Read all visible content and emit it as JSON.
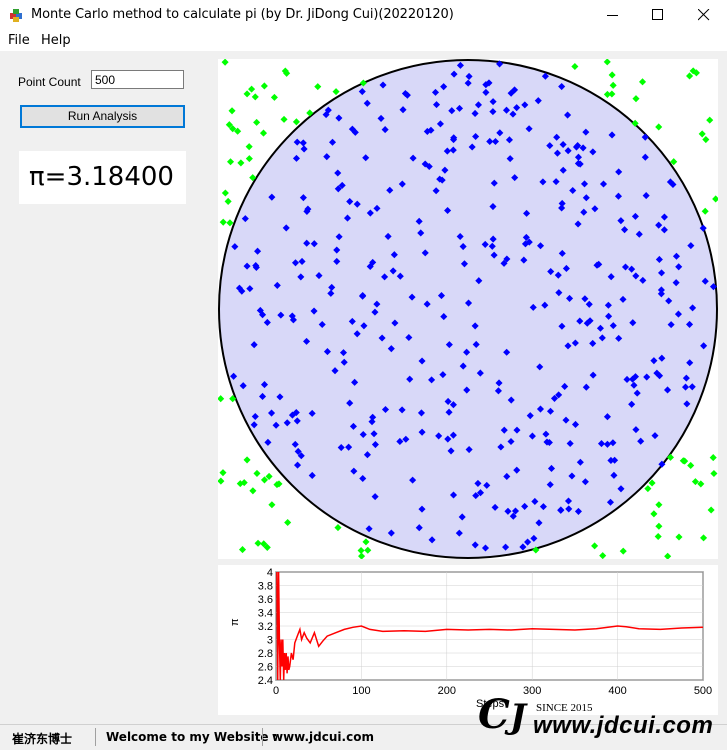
{
  "window": {
    "title": "Monte Carlo method to calculate pi (by Dr. JiDong Cui)(20220120)",
    "icon": "app-cube-icon"
  },
  "menu": {
    "items": [
      "File",
      "Help"
    ]
  },
  "controls": {
    "point_count_label": "Point Count",
    "point_count_value": "500",
    "run_label": "Run Analysis"
  },
  "result": {
    "pi_text": "π=3.18400"
  },
  "colors": {
    "inside": "#0000ff",
    "outside": "#00ff00",
    "circle_fill": "#d8d8f8",
    "line": "#ff0000"
  },
  "chart_data": {
    "type": "line",
    "xlabel": "Steps",
    "ylabel": "π",
    "xlim": [
      0,
      500
    ],
    "ylim": [
      2.4,
      4
    ],
    "x_ticks": [
      "0",
      "100",
      "200",
      "300",
      "400",
      "500"
    ],
    "y_ticks": [
      "2.4",
      "2.6",
      "2.8",
      "3",
      "3.2",
      "3.4",
      "3.6",
      "3.8",
      "4"
    ],
    "series": [
      {
        "x": [
          1,
          2,
          3,
          4,
          5,
          6,
          7,
          8,
          9,
          10,
          11,
          12,
          13,
          14,
          15,
          16,
          18,
          20,
          22,
          25,
          28,
          30,
          33,
          36,
          40,
          45,
          50,
          55,
          60,
          70,
          80,
          90,
          100,
          110,
          125,
          150,
          175,
          200,
          225,
          250,
          275,
          300,
          325,
          350,
          375,
          400,
          410,
          425,
          450,
          475,
          500
        ],
        "y": [
          4,
          2.4,
          4,
          3.0,
          2.4,
          3.0,
          2.6,
          3.0,
          2.4,
          2.8,
          2.55,
          2.8,
          2.5,
          2.75,
          2.55,
          2.6,
          2.8,
          2.7,
          2.95,
          3.05,
          3.15,
          3.0,
          3.1,
          3.02,
          2.95,
          3.1,
          2.9,
          2.98,
          3.05,
          3.1,
          3.15,
          3.18,
          3.2,
          3.15,
          3.12,
          3.13,
          3.12,
          3.15,
          3.14,
          3.15,
          3.14,
          3.16,
          3.15,
          3.14,
          3.16,
          3.2,
          3.19,
          3.16,
          3.15,
          3.17,
          3.18
        ]
      }
    ]
  },
  "statusbar": {
    "author": "崔济东博士",
    "welcome": "Welcome to my Website :",
    "url": "www.jdcui.com"
  },
  "watermark": {
    "since": "SINCE 2015",
    "url": "www.jdcui.com"
  }
}
